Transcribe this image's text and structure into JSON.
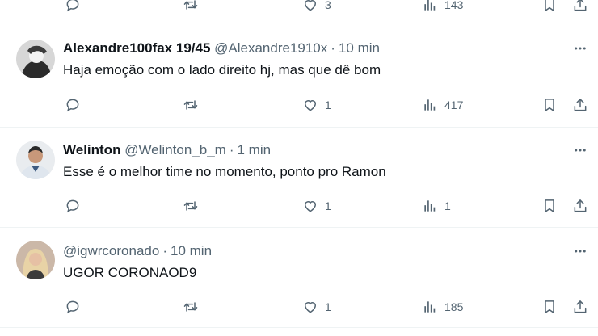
{
  "top_partial": {
    "likes": "3",
    "views": "143"
  },
  "posts": [
    {
      "name": "Alexandre100fax 19/45",
      "handle": "@Alexandre1910x",
      "time": "10 min",
      "text": "Haja emoção com o lado direito hj, mas que dê bom",
      "likes": "1",
      "views": "417"
    },
    {
      "name": "Welinton",
      "handle": "@Welinton_b_m",
      "time": "1 min",
      "text": "Esse é o melhor time no momento, ponto pro Ramon",
      "likes": "1",
      "views": "1"
    },
    {
      "name": "",
      "handle": "@igwrcoronado",
      "time": "10 min",
      "text": "UGOR CORONAOD9",
      "likes": "1",
      "views": "185"
    }
  ],
  "separator": "·",
  "icons": {
    "reply": "reply-icon",
    "retweet": "retweet-icon",
    "like": "heart-icon",
    "views": "views-icon",
    "bookmark": "bookmark-icon",
    "share": "share-icon",
    "more": "more-icon"
  }
}
